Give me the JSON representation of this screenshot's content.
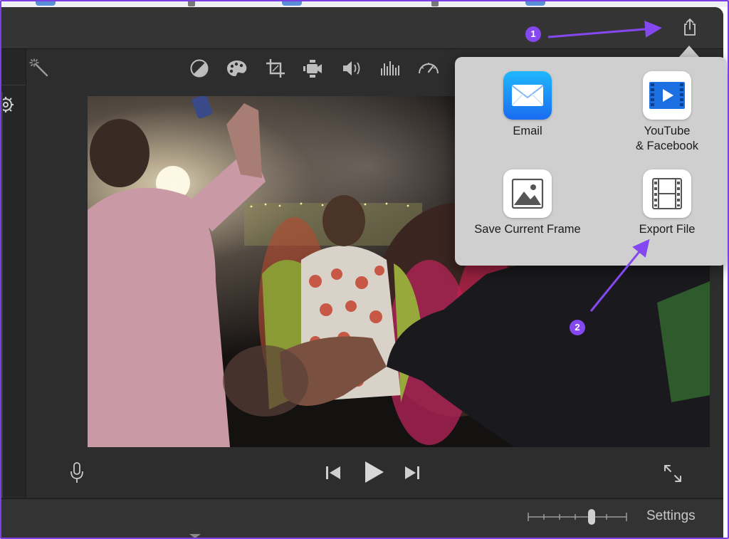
{
  "annotations": {
    "step1_badge": "1",
    "step2_badge": "2",
    "accent_color": "#8547f0"
  },
  "toolbar": {
    "share_icon": "share-icon",
    "tools": [
      "magic-wand-icon",
      "color-balance-icon",
      "color-correction-icon",
      "crop-icon",
      "stabilization-icon",
      "volume-icon",
      "noise-reduction-icon",
      "speed-icon"
    ]
  },
  "share_menu": {
    "items": [
      {
        "label": "Email",
        "icon": "mail-icon"
      },
      {
        "label": "YouTube\n& Facebook",
        "icon": "youtube-facebook-icon"
      },
      {
        "label": "Save Current Frame",
        "icon": "image-icon"
      },
      {
        "label": "Export File",
        "icon": "film-icon"
      }
    ]
  },
  "viewer": {
    "controls": [
      "microphone-icon",
      "skip-back-icon",
      "play-icon",
      "skip-forward-icon",
      "fullscreen-icon"
    ]
  },
  "bottom_bar": {
    "settings_label": "Settings"
  }
}
